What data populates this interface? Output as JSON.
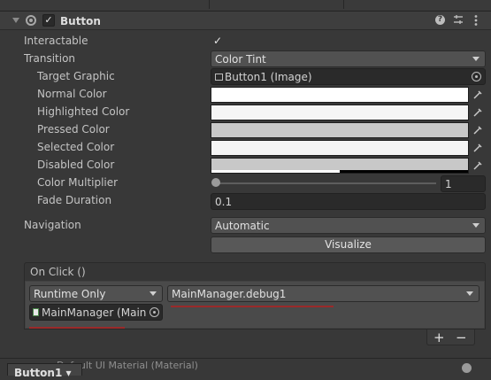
{
  "header": {
    "title": "Button",
    "enabled": true
  },
  "props": {
    "interactable": {
      "label": "Interactable",
      "checked": true
    },
    "transition": {
      "label": "Transition",
      "value": "Color Tint"
    },
    "target_graphic": {
      "label": "Target Graphic",
      "value": "Button1 (Image)"
    },
    "normal_color": {
      "label": "Normal Color",
      "color": "#ffffff"
    },
    "highlighted_color": {
      "label": "Highlighted Color",
      "color": "#f5f5f5"
    },
    "pressed_color": {
      "label": "Pressed Color",
      "color": "#c8c8c8"
    },
    "selected_color": {
      "label": "Selected Color",
      "color": "#f5f5f5"
    },
    "disabled_color": {
      "label": "Disabled Color",
      "color": "#c8c8c8",
      "alpha": 0.5
    },
    "color_multiplier": {
      "label": "Color Multiplier",
      "value": "1",
      "slider_level": 0
    },
    "fade_duration": {
      "label": "Fade Duration",
      "value": "0.1"
    },
    "navigation": {
      "label": "Navigation",
      "value": "Automatic"
    },
    "visualize": {
      "label": "Visualize"
    }
  },
  "onclick": {
    "title": "On Click ()",
    "runtime": "Runtime Only",
    "function": "MainManager.debug1",
    "object": "MainManager (Main",
    "plus": "+",
    "minus": "−"
  },
  "footer": {
    "label": "Button1 ▾",
    "behind_text": "Default UI Material (Material)"
  },
  "colors": {
    "underline": "#9a2a2a",
    "panel": "#383838",
    "field": "#2a2a2a"
  }
}
